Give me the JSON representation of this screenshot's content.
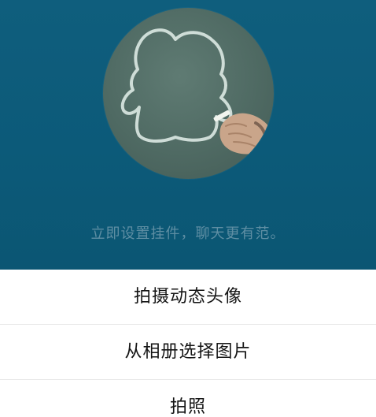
{
  "header": {
    "tagline": "立即设置挂件，聊天更有范。"
  },
  "avatar": {
    "icon": "chalk-penguin-silhouette-icon"
  },
  "menu": {
    "items": [
      {
        "label": "拍摄动态头像"
      },
      {
        "label": "从相册选择图片"
      },
      {
        "label": "拍照"
      }
    ]
  },
  "colors": {
    "header_background": "#0c5a79",
    "tagline_text": "#5e8ea3",
    "menu_background": "#ffffff",
    "menu_text": "#151515",
    "divider": "#e8e8e8"
  }
}
